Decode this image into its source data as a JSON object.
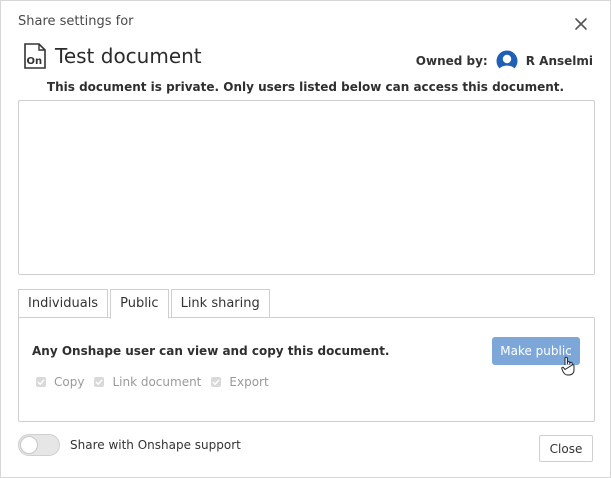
{
  "dialog": {
    "header_title": "Share settings for",
    "close_icon": "close-icon",
    "document": {
      "title": "Test document",
      "icon": "onshape-document-icon",
      "icon_text": "On"
    },
    "owner": {
      "label": "Owned by:",
      "name": "R Anselmi",
      "avatar_icon": "user-avatar-icon"
    },
    "privacy_note": "This document is private. Only users listed below can access this document.",
    "tabs": [
      {
        "label": "Individuals",
        "active": false
      },
      {
        "label": "Public",
        "active": true
      },
      {
        "label": "Link sharing",
        "active": false
      }
    ],
    "public_panel": {
      "description": "Any Onshape user can view and copy this document.",
      "make_public_label": "Make public",
      "permissions": [
        {
          "label": "Copy",
          "checked": true,
          "disabled": true
        },
        {
          "label": "Link document",
          "checked": true,
          "disabled": true
        },
        {
          "label": "Export",
          "checked": true,
          "disabled": true
        }
      ]
    },
    "support_toggle": {
      "label": "Share with Onshape support",
      "on": false
    },
    "close_label": "Close",
    "colors": {
      "primary_button": "#7da7d9",
      "avatar": "#1f5fb5"
    }
  }
}
